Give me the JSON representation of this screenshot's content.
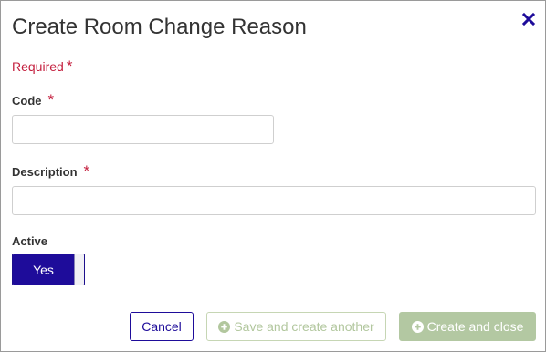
{
  "dialog": {
    "title": "Create Room Change Reason",
    "close_icon": "close-x-icon",
    "required_note": "Required",
    "required_marker": "*"
  },
  "fields": {
    "code": {
      "label": "Code",
      "required_marker": "*",
      "value": ""
    },
    "description": {
      "label": "Description",
      "required_marker": "*",
      "value": ""
    },
    "active": {
      "label": "Active",
      "toggle_label": "Yes",
      "state": "on"
    }
  },
  "footer": {
    "cancel_label": "Cancel",
    "save_another_label": "Save and create another",
    "save_another_icon": "plus-circle-icon",
    "create_close_label": "Create and close",
    "create_close_icon": "plus-circle-icon"
  },
  "colors": {
    "accent": "#1e0c9a",
    "required": "#c41f3e",
    "disabled_green": "#b3c8a2",
    "title_text": "#333333"
  }
}
